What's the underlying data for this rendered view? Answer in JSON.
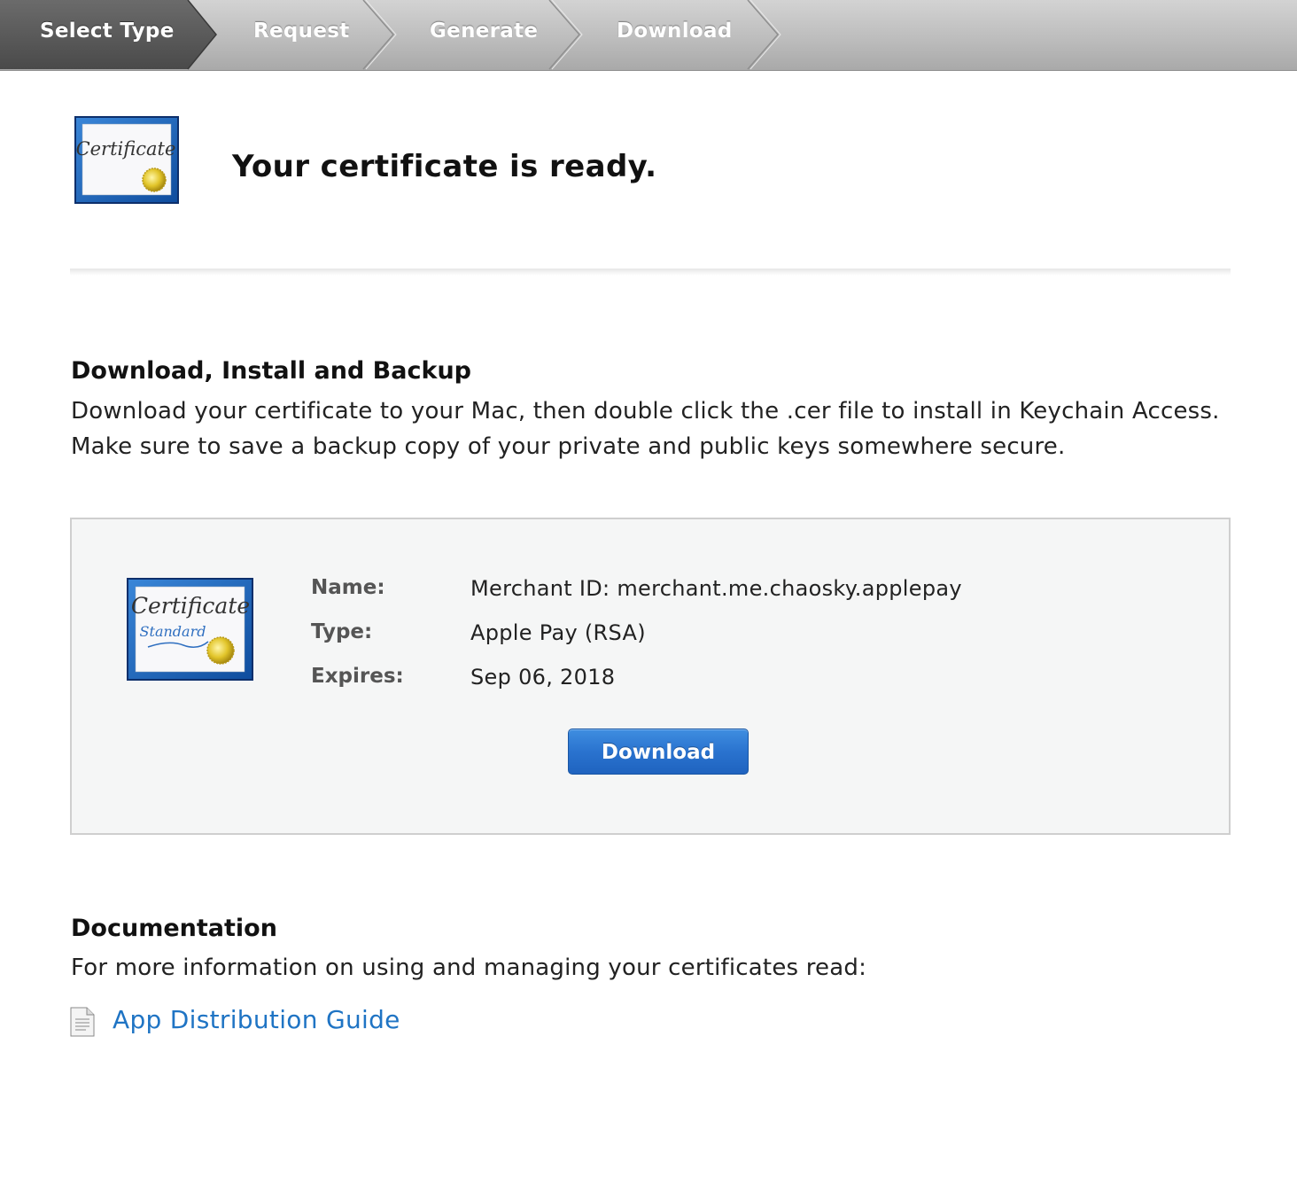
{
  "steps": [
    {
      "label": "Select Type",
      "active": true
    },
    {
      "label": "Request",
      "active": false
    },
    {
      "label": "Generate",
      "active": false
    },
    {
      "label": "Download",
      "active": false
    }
  ],
  "header": {
    "title": "Your certificate is ready.",
    "icon": "certificate-icon",
    "icon_text": "Certificate"
  },
  "download_section": {
    "heading": "Download, Install and Backup",
    "text": "Download your certificate to your Mac, then double click the .cer file to install in Keychain Access. Make sure to save a backup copy of your private and public keys somewhere secure."
  },
  "certificate": {
    "icon": "certificate-standard-icon",
    "icon_text": "Certificate",
    "icon_subtext": "Standard",
    "name_label": "Name:",
    "name_value": "Merchant ID: merchant.me.chaosky.applepay",
    "type_label": "Type:",
    "type_value": "Apple Pay (RSA)",
    "expires_label": "Expires:",
    "expires_value": "Sep 06, 2018",
    "download_label": "Download"
  },
  "documentation": {
    "heading": "Documentation",
    "text": "For more information on using and managing your certificates read:",
    "link_label": "App Distribution Guide",
    "link_icon": "document-icon"
  },
  "colors": {
    "accent": "#2a73cf",
    "link": "#1f74c4",
    "panel_bg": "#f5f6f6"
  }
}
